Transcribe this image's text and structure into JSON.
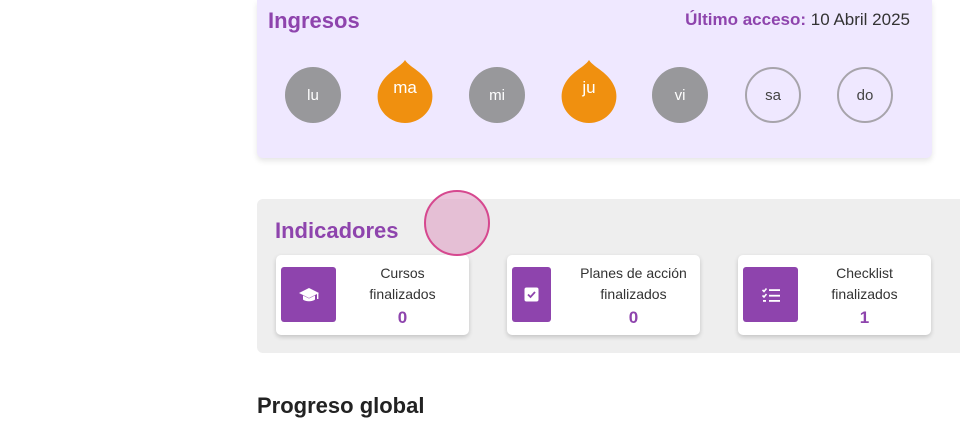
{
  "ingresos": {
    "title": "Ingresos",
    "last_access_label": "Último acceso:",
    "last_access_value": " 10 Abril 2025",
    "days": [
      {
        "label": "lu",
        "state": "gray"
      },
      {
        "label": "ma",
        "state": "fire"
      },
      {
        "label": "mi",
        "state": "gray"
      },
      {
        "label": "ju",
        "state": "fire"
      },
      {
        "label": "vi",
        "state": "gray"
      },
      {
        "label": "sa",
        "state": "outline"
      },
      {
        "label": "do",
        "state": "outline"
      }
    ]
  },
  "indicadores": {
    "title": "Indicadores",
    "cards": [
      {
        "label_line1": "Cursos",
        "label_line2": "finalizados",
        "value": "0",
        "icon": "graduation-cap-icon"
      },
      {
        "label_line1": "Planes de acción",
        "label_line2": "finalizados",
        "value": "0",
        "icon": "checkbox-icon"
      },
      {
        "label_line1": "Checklist",
        "label_line2": "finalizados",
        "value": "1",
        "icon": "checklist-icon"
      }
    ]
  },
  "progreso": {
    "title": "Progreso global"
  },
  "colors": {
    "accent": "#8e44ad",
    "fire": "#f0900f",
    "panel_purple": "#efe8ff",
    "panel_gray": "#eeeeee"
  }
}
